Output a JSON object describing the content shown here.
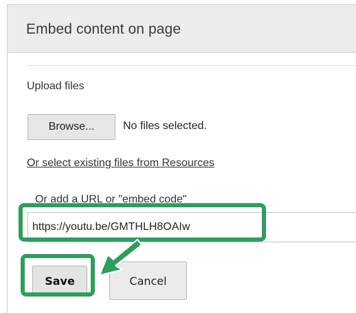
{
  "dialog": {
    "title": "Embed content on page",
    "upload_label": "Upload files",
    "browse_label": "Browse...",
    "no_files_text": "No files selected.",
    "resources_link": "Or select existing files from Resources",
    "url_label": "Or add a URL or \"embed code\"",
    "url_value": "https://youtu.be/GMTHLH8OAIw",
    "save_label": "Save",
    "cancel_label": "Cancel"
  },
  "annotation": {
    "highlight_color": "#2e9e5e",
    "arrow_icon": "arrow-down-left-icon"
  }
}
